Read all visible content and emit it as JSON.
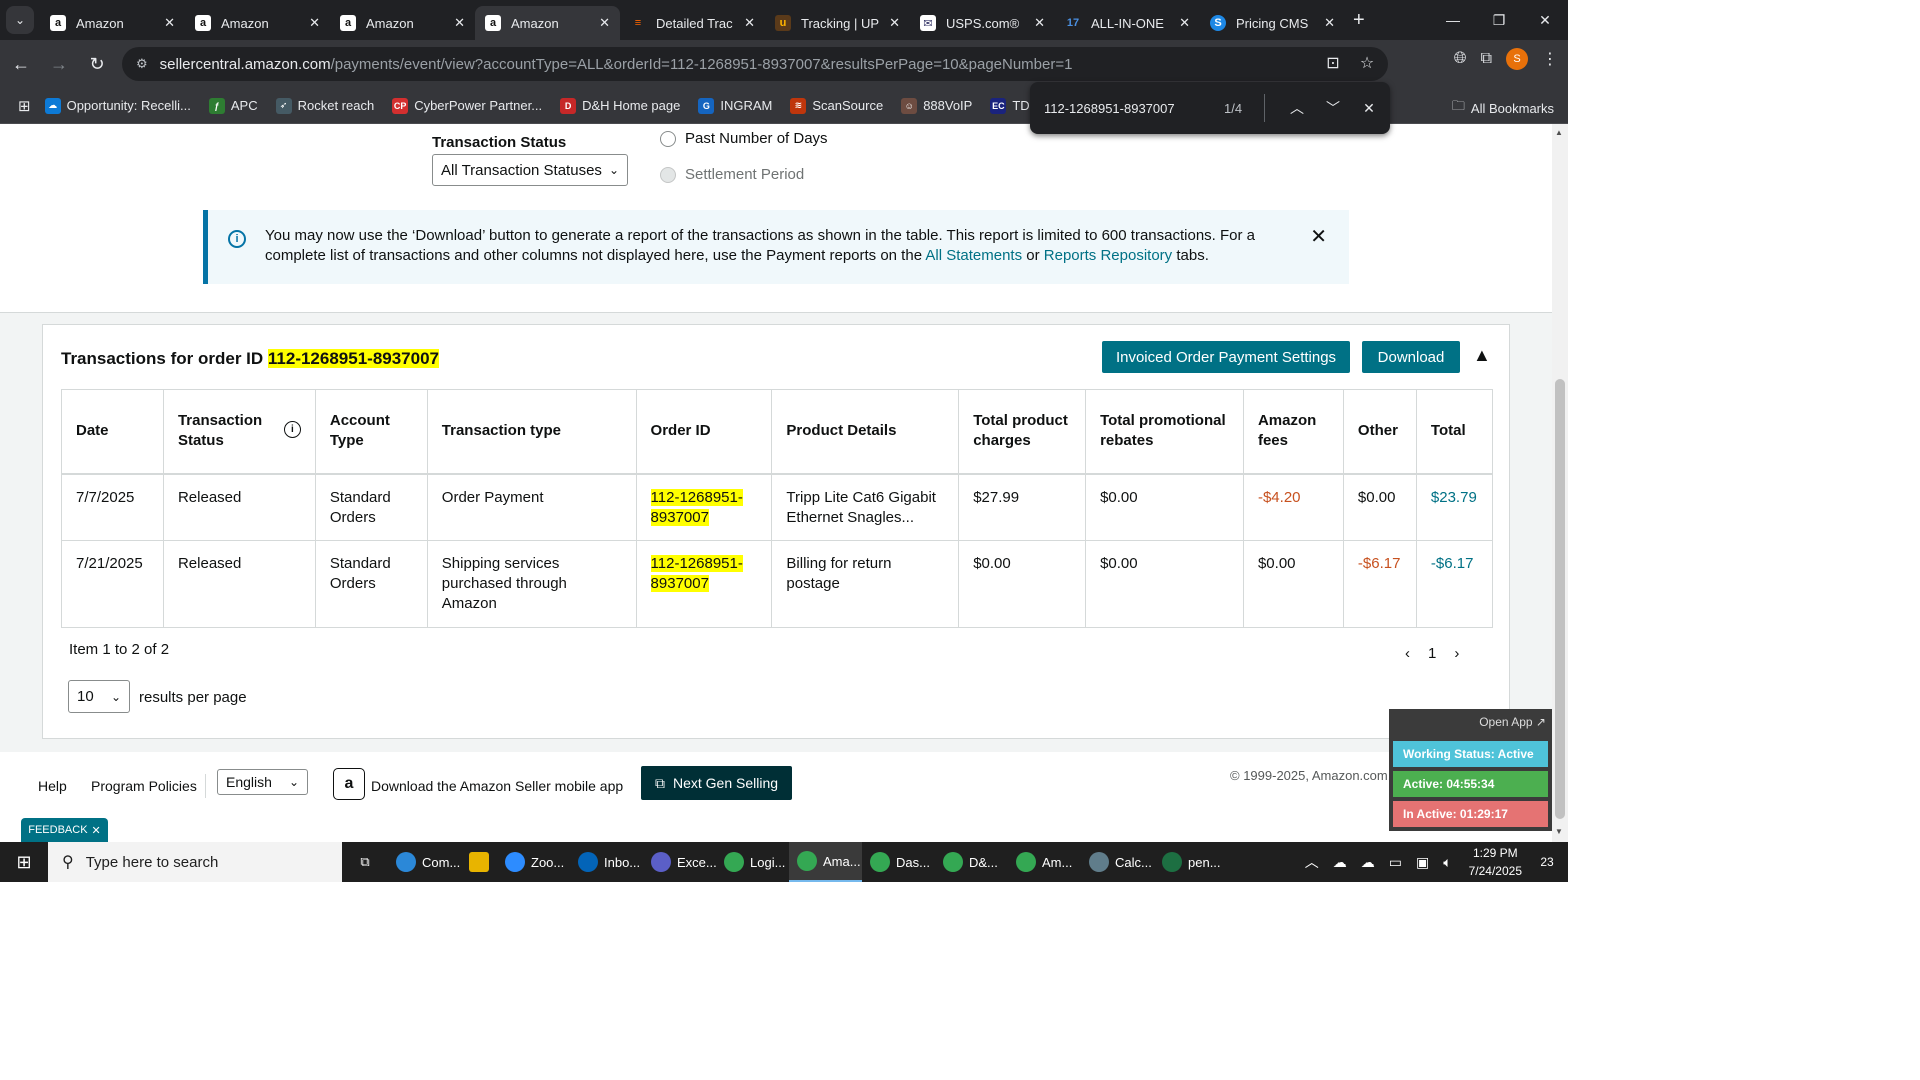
{
  "browser": {
    "tabs": [
      {
        "title": "Amazon",
        "favicon": "amazon-a",
        "active": false
      },
      {
        "title": "Amazon",
        "favicon": "amazon-a",
        "active": false
      },
      {
        "title": "Amazon",
        "favicon": "amazon-a",
        "active": false
      },
      {
        "title": "Amazon",
        "favicon": "amazon-a",
        "active": true
      },
      {
        "title": "Detailed Trac",
        "favicon": "fedex",
        "active": false
      },
      {
        "title": "Tracking | UP",
        "favicon": "ups",
        "active": false
      },
      {
        "title": "USPS.com®",
        "favicon": "usps",
        "active": false
      },
      {
        "title": "ALL-IN-ONE",
        "favicon": "17track",
        "active": false
      },
      {
        "title": "Pricing CMS",
        "favicon": "s-circle",
        "active": false
      }
    ],
    "url_host": "sellercentral.amazon.com",
    "url_path": "/payments/event/view?accountType=ALL&orderId=112-1268951-8937007&resultsPerPage=10&pageNumber=1",
    "profile_initial": "S",
    "bookmarks": [
      {
        "label": "Opportunity: Recelli...",
        "color": "#0d7ad6",
        "glyph": "☁"
      },
      {
        "label": "APC",
        "color": "#2e7d32",
        "glyph": "ƒ"
      },
      {
        "label": "Rocket reach",
        "color": "#455a64",
        "glyph": "➶"
      },
      {
        "label": "CyberPower Partner...",
        "color": "#d32f2f",
        "glyph": "CP"
      },
      {
        "label": "D&H Home page",
        "color": "#c62828",
        "glyph": "D"
      },
      {
        "label": "INGRAM",
        "color": "#1565c0",
        "glyph": "G"
      },
      {
        "label": "ScanSource",
        "color": "#bf360c",
        "glyph": "≋"
      },
      {
        "label": "888VoIP",
        "color": "#6d4c41",
        "glyph": "☺"
      },
      {
        "label": "TD SYNN",
        "color": "#1a237e",
        "glyph": "EC"
      }
    ],
    "all_bookmarks": "All Bookmarks"
  },
  "findbar": {
    "query": "112-1268951-8937007",
    "count": "1/4"
  },
  "filters": {
    "status_label": "Transaction Status",
    "status_value": "All Transaction Statuses",
    "radio_days": "Past Number of Days",
    "radio_settlement": "Settlement Period"
  },
  "info": {
    "text_1": "You may now use the ‘Download’ button to generate a report of the transactions as shown in the table. This report is limited to 600 transactions. For a complete list of transactions and other columns not displayed here, use the Payment reports on the ",
    "link_statements": "All Statements",
    "text_or": " or ",
    "link_repository": "Reports Repository",
    "text_end": " tabs."
  },
  "card": {
    "title_prefix": "Transactions for order ID ",
    "order_id": "112-1268951-8937007",
    "btn_settings": "Invoiced Order Payment Settings",
    "btn_download": "Download"
  },
  "table": {
    "columns": [
      "Date",
      "Transaction Status",
      "Account Type",
      "Transaction type",
      "Order ID",
      "Product Details",
      "Total product charges",
      "Total promotional rebates",
      "Amazon fees",
      "Other",
      "Total"
    ],
    "rows": [
      {
        "date": "7/7/2025",
        "status": "Released",
        "account": "Standard Orders",
        "type": "Order Payment",
        "order_id": "112-1268951-8937007",
        "product": "Tripp Lite Cat6 Gigabit Ethernet Snagles...",
        "charges": "$27.99",
        "rebates": "$0.00",
        "fees": "-$4.20",
        "other": "$0.00",
        "total": "$23.79"
      },
      {
        "date": "7/21/2025",
        "status": "Released",
        "account": "Standard Orders",
        "type": "Shipping services purchased through Amazon",
        "order_id": "112-1268951-8937007",
        "product": "Billing for return postage",
        "charges": "$0.00",
        "rebates": "$0.00",
        "fees": "$0.00",
        "other": "-$6.17",
        "total": "-$6.17"
      }
    ]
  },
  "pagination": {
    "summary": "Item 1 to 2 of 2",
    "current_page": "1",
    "per_page_value": "10",
    "per_page_label": "results per page"
  },
  "footer": {
    "help": "Help",
    "policies": "Program Policies",
    "language": "English",
    "app_text": "Download the Amazon Seller mobile app",
    "next_gen": "Next Gen Selling",
    "copyright": "© 1999-2025, Amazon.com, Inc. or its affiliates",
    "feedback": "FEEDBACK"
  },
  "widget": {
    "open_app": "Open App ↗",
    "working": "Working Status: Active",
    "active": "Active: 04:55:34",
    "inactive": "In Active: 01:29:17"
  },
  "taskbar": {
    "search_placeholder": "Type here to search",
    "items": [
      {
        "label": "Com...",
        "color": "#2b88d8"
      },
      {
        "label": "",
        "color": "#e8b400"
      },
      {
        "label": "Zoo...",
        "color": "#2d8cff"
      },
      {
        "label": "Inbo...",
        "color": "#0364b8"
      },
      {
        "label": "Exce...",
        "color": "#5b5fc7"
      },
      {
        "label": "Logi...",
        "color": "#34a853"
      },
      {
        "label": "Ama...",
        "color": "#34a853"
      },
      {
        "label": "Das...",
        "color": "#34a853"
      },
      {
        "label": "D&...",
        "color": "#34a853"
      },
      {
        "label": "Am...",
        "color": "#34a853"
      },
      {
        "label": "Calc...",
        "color": "#607d8b"
      },
      {
        "label": "pen...",
        "color": "#1d6f42"
      }
    ],
    "time": "1:29 PM",
    "date": "7/24/2025",
    "notifications": "23"
  },
  "colors": {
    "accent": "#007185",
    "negative": "#c7511f",
    "highlight": "#ffff00"
  }
}
